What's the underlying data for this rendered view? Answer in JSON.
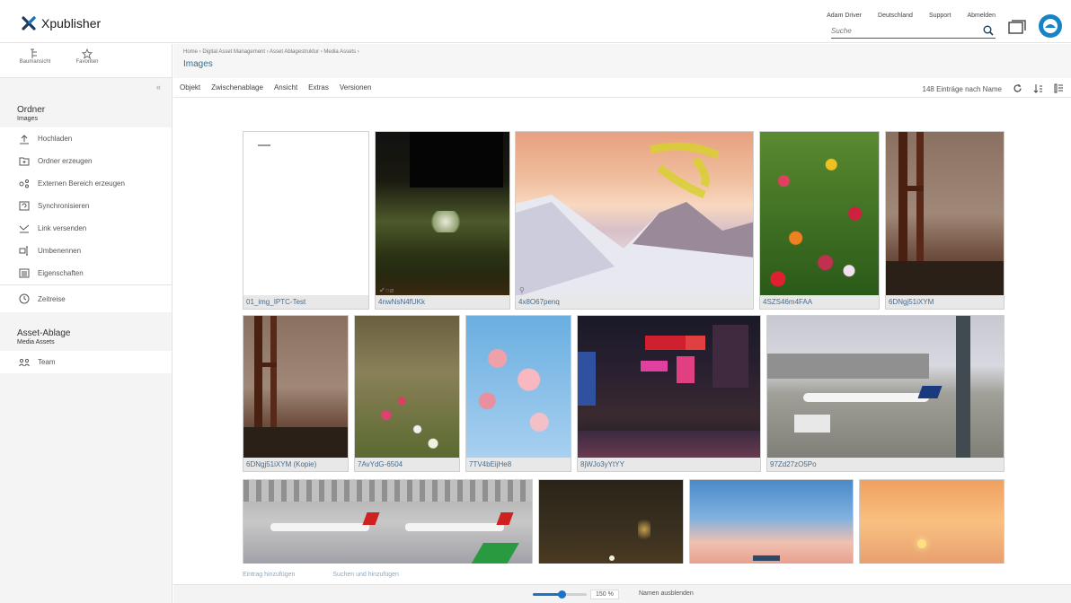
{
  "app": {
    "name": "Xpublisher",
    "colors": {
      "accent": "#1a73c7",
      "title": "#2a6fa0"
    }
  },
  "header": {
    "nav": [
      "Adam Driver",
      "Deutschland",
      "Support",
      "Abmelden"
    ],
    "search_placeholder": "Suche"
  },
  "sidebar": {
    "top": [
      {
        "label": "Baumansicht",
        "icon": "tree-view-icon"
      },
      {
        "label": "Favoriten",
        "icon": "star-icon"
      }
    ],
    "folder": {
      "title": "Ordner",
      "subtitle": "Images"
    },
    "actions": [
      {
        "label": "Hochladen",
        "icon": "upload-icon"
      },
      {
        "label": "Ordner erzeugen",
        "icon": "folder-create-icon"
      },
      {
        "label": "Externen Bereich erzeugen",
        "icon": "external-area-icon"
      },
      {
        "label": "Synchronisieren",
        "icon": "sync-icon"
      },
      {
        "label": "Link versenden",
        "icon": "send-link-icon"
      },
      {
        "label": "Umbenennen",
        "icon": "rename-icon"
      },
      {
        "label": "Eigenschaften",
        "icon": "properties-icon"
      }
    ],
    "time": {
      "label": "Zeitreise",
      "icon": "clock-icon"
    },
    "asset": {
      "title": "Asset-Ablage",
      "subtitle": "Media Assets"
    },
    "team": {
      "label": "Team",
      "icon": "team-icon"
    }
  },
  "main": {
    "breadcrumb": "Home  ›  Digital Asset Management  ›  Asset Ablagestruktur  ›  Media Assets  ›",
    "title": "Images",
    "menus": [
      "Objekt",
      "Zwischenablage",
      "Ansicht",
      "Extras",
      "Versionen"
    ],
    "count": "148 Einträge nach Name",
    "tiles": [
      {
        "caption": "01_img_IPTC-Test"
      },
      {
        "caption": "4nwNsN4fUKk"
      },
      {
        "caption": "4x8O67penq"
      },
      {
        "caption": "4SZS46m4FAA"
      },
      {
        "caption": "6DNgj51iXYM"
      },
      {
        "caption": "6DNgj51iXYM (Kopie)"
      },
      {
        "caption": "7AvYdG-6504"
      },
      {
        "caption": "7TV4bEijHe8"
      },
      {
        "caption": "8jWJo3yYtYY"
      },
      {
        "caption": "97Zd27zO5Po"
      },
      {
        "caption": ""
      },
      {
        "caption": ""
      },
      {
        "caption": ""
      },
      {
        "caption": ""
      }
    ],
    "footer_links": [
      "Eintrag hinzufügen",
      "Suchen und hinzufügen"
    ],
    "zoom": "150 %",
    "toggle_names": "Namen ausblenden"
  }
}
